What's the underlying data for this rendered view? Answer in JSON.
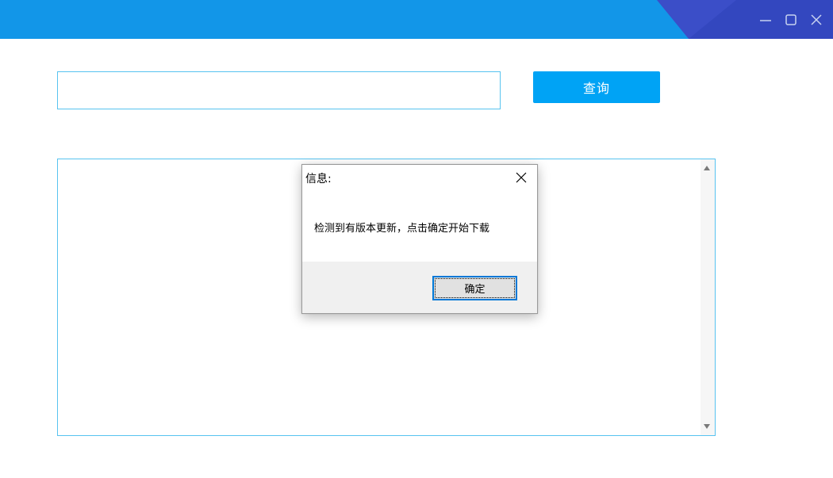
{
  "window": {
    "titlebar_color": "#1296e8",
    "accent_color": "#3d4fc8",
    "controls": {
      "minimize_icon": "minimize-icon",
      "maximize_icon": "maximize-icon",
      "close_icon": "close-icon"
    }
  },
  "search": {
    "value": "",
    "placeholder": "",
    "button_label": "查询",
    "button_color": "#00a3f5",
    "border_color": "#57c3f0"
  },
  "results": {
    "text": ""
  },
  "dialog": {
    "title": "信息:",
    "message": "检测到有版本更新，点击确定开始下载",
    "ok_label": "确定",
    "close_icon": "close-icon"
  }
}
